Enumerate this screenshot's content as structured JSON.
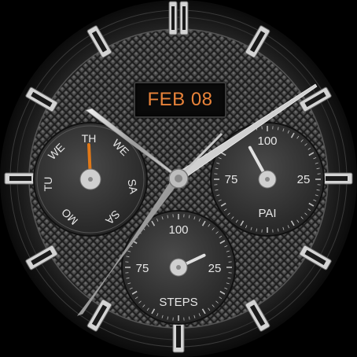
{
  "date": {
    "text": "FEB 08",
    "color": "#e8833a"
  },
  "day_dial": {
    "labels": [
      "TH",
      "WE",
      "SA",
      "SA",
      "MO",
      "TU",
      "WE"
    ],
    "current_day": "TH",
    "hand_color": "#e07818"
  },
  "pai_dial": {
    "title": "PAI",
    "ticks": [
      "100",
      "75",
      "25"
    ],
    "level": 0.08
  },
  "steps_dial": {
    "title": "STEPS",
    "ticks": [
      "100",
      "75",
      "25"
    ],
    "level": 0.82
  },
  "colors": {
    "bezel": "#1b1b1b",
    "dial_bg": "#262626",
    "subdial_bg": "#3a3a3a",
    "hands": "#d8d8d8",
    "accent": "#e8833a"
  }
}
